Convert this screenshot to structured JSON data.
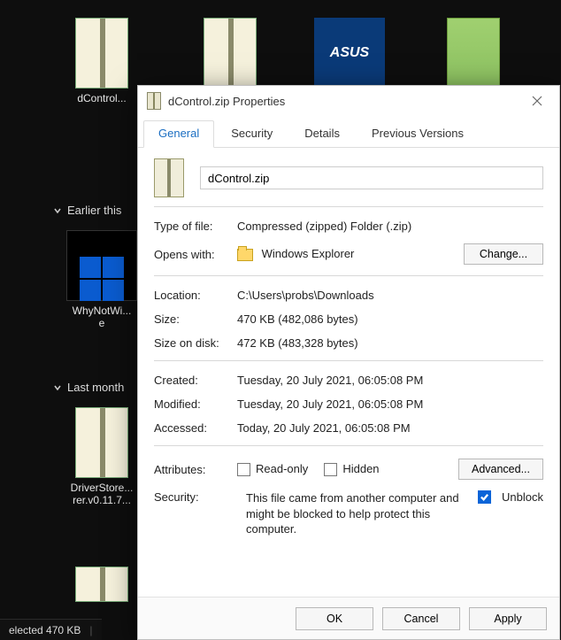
{
  "explorer": {
    "items": [
      {
        "label": "dControl..."
      },
      {
        "label": ""
      },
      {
        "label": "ASUS"
      },
      {
        "label": ""
      },
      {
        "label": "WhyNotWi...\ne"
      },
      {
        "label": "DriverStore...\nrer.v0.11.7..."
      }
    ],
    "groups": {
      "earlier": "Earlier this",
      "last_month": "Last month"
    },
    "statusbar": "elected  470 KB"
  },
  "dialog": {
    "title": "dControl.zip Properties",
    "tabs": [
      "General",
      "Security",
      "Details",
      "Previous Versions"
    ],
    "filename": "dControl.zip",
    "labels": {
      "type": "Type of file:",
      "opens": "Opens with:",
      "change": "Change...",
      "location": "Location:",
      "size": "Size:",
      "size_disk": "Size on disk:",
      "created": "Created:",
      "modified": "Modified:",
      "accessed": "Accessed:",
      "attributes": "Attributes:",
      "readonly": "Read-only",
      "hidden": "Hidden",
      "advanced": "Advanced...",
      "security": "Security:",
      "unblock": "Unblock"
    },
    "values": {
      "type": "Compressed (zipped) Folder (.zip)",
      "opens": "Windows Explorer",
      "location": "C:\\Users\\probs\\Downloads",
      "size": "470 KB (482,086 bytes)",
      "size_disk": "472 KB (483,328 bytes)",
      "created": "Tuesday, 20 July 2021, 06:05:08 PM",
      "modified": "Tuesday, 20 July 2021, 06:05:08 PM",
      "accessed": "Today, 20 July 2021, 06:05:08 PM",
      "security": "This file came from another computer and might be blocked to help protect this computer."
    },
    "buttons": {
      "ok": "OK",
      "cancel": "Cancel",
      "apply": "Apply"
    }
  }
}
